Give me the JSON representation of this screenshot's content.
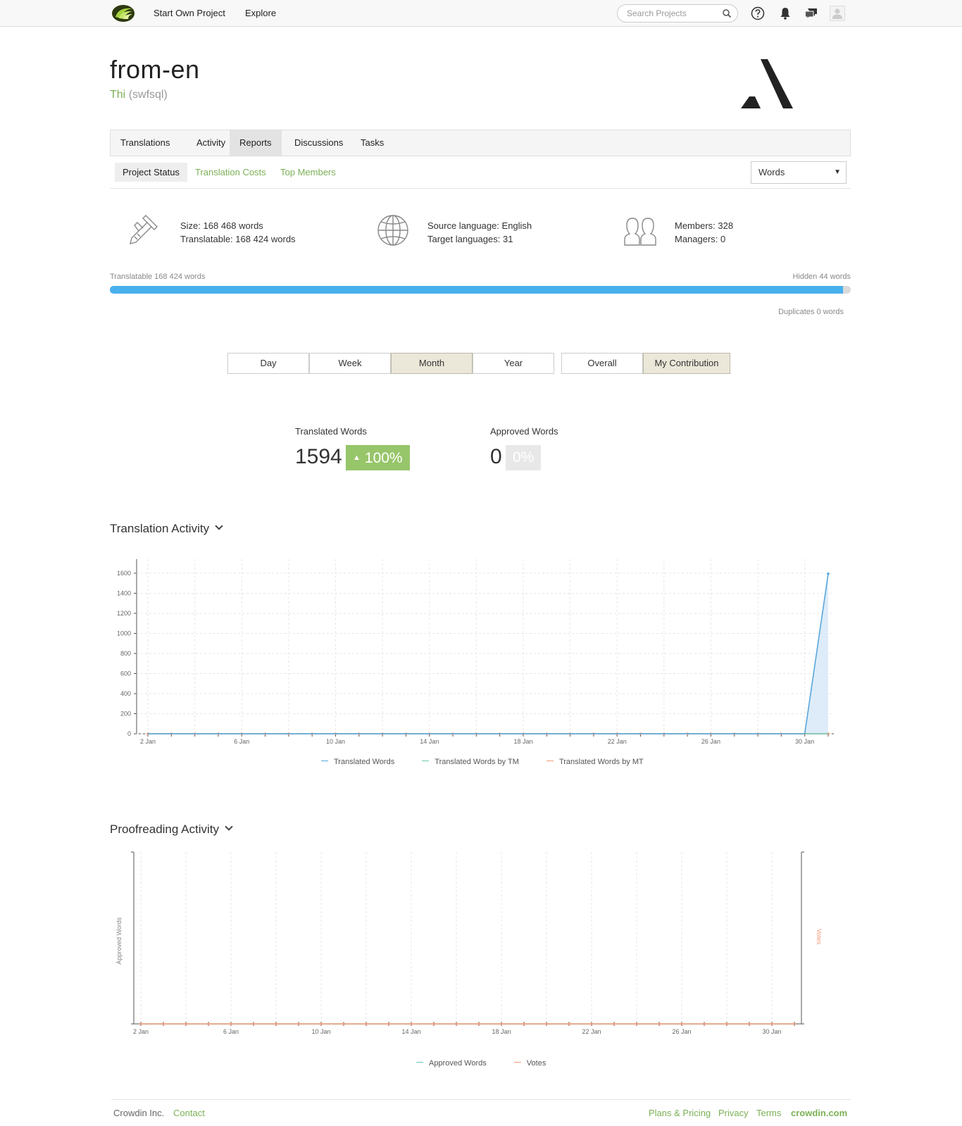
{
  "nav": {
    "start_project": "Start Own Project",
    "explore": "Explore",
    "search_placeholder": "Search Projects"
  },
  "project": {
    "title": "from-en",
    "owner_name": "Thi",
    "owner_handle": "(swfsql)"
  },
  "tabs": [
    {
      "label": "Translations"
    },
    {
      "label": "Activity"
    },
    {
      "label": "Reports",
      "active": true
    },
    {
      "label": "Discussions"
    },
    {
      "label": "Tasks"
    }
  ],
  "subtabs": [
    {
      "label": "Project Status",
      "active": true
    },
    {
      "label": "Translation Costs"
    },
    {
      "label": "Top Members"
    }
  ],
  "unit_select": {
    "value": "Words"
  },
  "stats": {
    "size": "Size: 168 468 words",
    "translatable": "Translatable: 168 424 words",
    "source_language": "Source language: English",
    "target_languages": "Target languages: 31",
    "members": "Members: 328",
    "managers": "Managers: 0"
  },
  "progress": {
    "left_label": "Translatable 168 424 words",
    "right_label": "Hidden 44 words",
    "duplicates_label": "Duplicates 0 words",
    "translatable_fraction": 0.99
  },
  "period_buttons": [
    {
      "label": "Day"
    },
    {
      "label": "Week"
    },
    {
      "label": "Month",
      "active": true
    },
    {
      "label": "Year"
    }
  ],
  "scope_buttons": [
    {
      "label": "Overall"
    },
    {
      "label": "My Contribution",
      "active": true
    }
  ],
  "totals": {
    "translated_label": "Translated Words",
    "translated_value": "1594",
    "translated_change": "100%",
    "approved_label": "Approved Words",
    "approved_value": "0",
    "approved_change": "0%"
  },
  "translation_section": {
    "title": "Translation Activity"
  },
  "proofreading_section": {
    "title": "Proofreading Activity"
  },
  "colors": {
    "accent_green": "#7bb055",
    "progress_blue": "#48b0ec",
    "series_blue": "#5aa7de",
    "series_teal": "#6ac8b4",
    "series_orange": "#f29a77"
  },
  "chart_data": [
    {
      "type": "area",
      "x_days": [
        2,
        3,
        4,
        5,
        6,
        7,
        8,
        9,
        10,
        11,
        12,
        13,
        14,
        15,
        16,
        17,
        18,
        19,
        20,
        21,
        22,
        23,
        24,
        25,
        26,
        27,
        28,
        29,
        30,
        31
      ],
      "x_tick_labels": [
        "2 Jan",
        "6 Jan",
        "10 Jan",
        "14 Jan",
        "18 Jan",
        "22 Jan",
        "26 Jan",
        "30 Jan"
      ],
      "ylim": [
        0,
        1600
      ],
      "y_ticks": [
        0,
        200,
        400,
        600,
        800,
        1000,
        1200,
        1400,
        1600
      ],
      "grid": true,
      "series": [
        {
          "name": "Translated Words",
          "values": [
            0,
            0,
            0,
            0,
            0,
            0,
            0,
            0,
            0,
            0,
            0,
            0,
            0,
            0,
            0,
            0,
            0,
            0,
            0,
            0,
            0,
            0,
            0,
            0,
            0,
            0,
            0,
            0,
            0,
            1594
          ]
        },
        {
          "name": "Translated Words by TM",
          "values": [
            0,
            0,
            0,
            0,
            0,
            0,
            0,
            0,
            0,
            0,
            0,
            0,
            0,
            0,
            0,
            0,
            0,
            0,
            0,
            0,
            0,
            0,
            0,
            0,
            0,
            0,
            0,
            0,
            0,
            0
          ]
        },
        {
          "name": "Translated Words by MT",
          "values": [
            0,
            0,
            0,
            0,
            0,
            0,
            0,
            0,
            0,
            0,
            0,
            0,
            0,
            0,
            0,
            0,
            0,
            0,
            0,
            0,
            0,
            0,
            0,
            0,
            0,
            0,
            0,
            0,
            0,
            0
          ]
        }
      ],
      "legend_position": "bottom"
    },
    {
      "type": "line",
      "x_days": [
        2,
        3,
        4,
        5,
        6,
        7,
        8,
        9,
        10,
        11,
        12,
        13,
        14,
        15,
        16,
        17,
        18,
        19,
        20,
        21,
        22,
        23,
        24,
        25,
        26,
        27,
        28,
        29,
        30,
        31
      ],
      "x_tick_labels": [
        "2 Jan",
        "6 Jan",
        "10 Jan",
        "14 Jan",
        "18 Jan",
        "22 Jan",
        "26 Jan",
        "30 Jan"
      ],
      "ylabel": "Approved Words",
      "y2label": "Votes",
      "grid": true,
      "series": [
        {
          "name": "Approved Words",
          "values": [
            0,
            0,
            0,
            0,
            0,
            0,
            0,
            0,
            0,
            0,
            0,
            0,
            0,
            0,
            0,
            0,
            0,
            0,
            0,
            0,
            0,
            0,
            0,
            0,
            0,
            0,
            0,
            0,
            0,
            0
          ]
        },
        {
          "name": "Votes",
          "values": [
            0,
            0,
            0,
            0,
            0,
            0,
            0,
            0,
            0,
            0,
            0,
            0,
            0,
            0,
            0,
            0,
            0,
            0,
            0,
            0,
            0,
            0,
            0,
            0,
            0,
            0,
            0,
            0,
            0,
            0
          ]
        }
      ],
      "legend_position": "bottom"
    }
  ],
  "footer": {
    "company": "Crowdin Inc.",
    "contact": "Contact",
    "plans": "Plans & Pricing",
    "privacy": "Privacy",
    "terms": "Terms",
    "site": "crowdin.com"
  }
}
